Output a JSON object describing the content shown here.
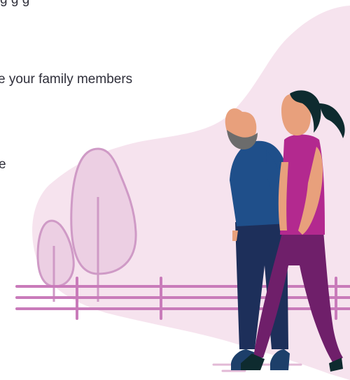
{
  "content": {
    "line1": "g         g  g",
    "line2": "e your family members",
    "line3": "e"
  },
  "illustration": {
    "colors": {
      "blob": "#f6e3ee",
      "tree_fill": "#eccfe3",
      "tree_stroke": "#cf9ac6",
      "fence": "#c97bba",
      "skin": "#e8a07c",
      "beard": "#6c6c6c",
      "man_top": "#1f4f8a",
      "man_pants": "#1d2f5a",
      "woman_top": "#b3298f",
      "woman_pants": "#6f1f6a",
      "hair": "#0e2b2f",
      "shoes": "#1d3f6a"
    }
  }
}
